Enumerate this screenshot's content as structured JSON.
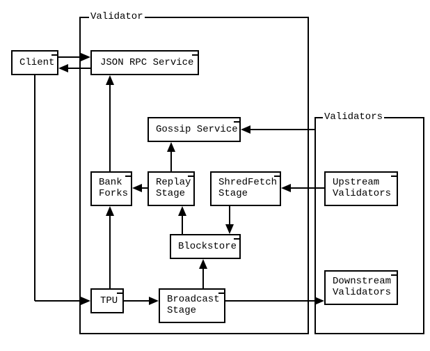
{
  "diagram": {
    "validator_title": "Validator",
    "validators_title": "Validators",
    "client": "Client",
    "json_rpc": "JSON RPC Service",
    "gossip": "Gossip Service",
    "bank_forks": "Bank\nForks",
    "replay_stage": "Replay\nStage",
    "shredfetch_stage": "ShredFetch\nStage",
    "blockstore": "Blockstore",
    "tpu": "TPU",
    "broadcast_stage": "Broadcast\nStage",
    "upstream": "Upstream\nValidators",
    "downstream": "Downstream\nValidators"
  },
  "chart_data": {
    "type": "diagram",
    "title": "Validator architecture",
    "nodes": [
      {
        "id": "client",
        "label": "Client"
      },
      {
        "id": "validator",
        "label": "Validator",
        "container": true
      },
      {
        "id": "json_rpc",
        "label": "JSON RPC Service",
        "parent": "validator"
      },
      {
        "id": "gossip",
        "label": "Gossip Service",
        "parent": "validator"
      },
      {
        "id": "bank_forks",
        "label": "Bank Forks",
        "parent": "validator"
      },
      {
        "id": "replay_stage",
        "label": "Replay Stage",
        "parent": "validator"
      },
      {
        "id": "shredfetch_stage",
        "label": "ShredFetch Stage",
        "parent": "validator"
      },
      {
        "id": "blockstore",
        "label": "Blockstore",
        "parent": "validator"
      },
      {
        "id": "tpu",
        "label": "TPU",
        "parent": "validator"
      },
      {
        "id": "broadcast_stage",
        "label": "Broadcast Stage",
        "parent": "validator"
      },
      {
        "id": "validators",
        "label": "Validators",
        "container": true
      },
      {
        "id": "upstream",
        "label": "Upstream Validators",
        "parent": "validators"
      },
      {
        "id": "downstream",
        "label": "Downstream Validators",
        "parent": "validators"
      }
    ],
    "edges": [
      {
        "from": "client",
        "to": "json_rpc",
        "dir": "both"
      },
      {
        "from": "client",
        "to": "tpu"
      },
      {
        "from": "tpu",
        "to": "broadcast_stage"
      },
      {
        "from": "tpu",
        "to": "bank_forks"
      },
      {
        "from": "bank_forks",
        "to": "json_rpc"
      },
      {
        "from": "replay_stage",
        "to": "bank_forks"
      },
      {
        "from": "replay_stage",
        "to": "gossip"
      },
      {
        "from": "blockstore",
        "to": "replay_stage"
      },
      {
        "from": "shredfetch_stage",
        "to": "blockstore"
      },
      {
        "from": "broadcast_stage",
        "to": "blockstore"
      },
      {
        "from": "validators",
        "to": "gossip"
      },
      {
        "from": "upstream",
        "to": "shredfetch_stage"
      },
      {
        "from": "broadcast_stage",
        "to": "downstream"
      }
    ]
  }
}
